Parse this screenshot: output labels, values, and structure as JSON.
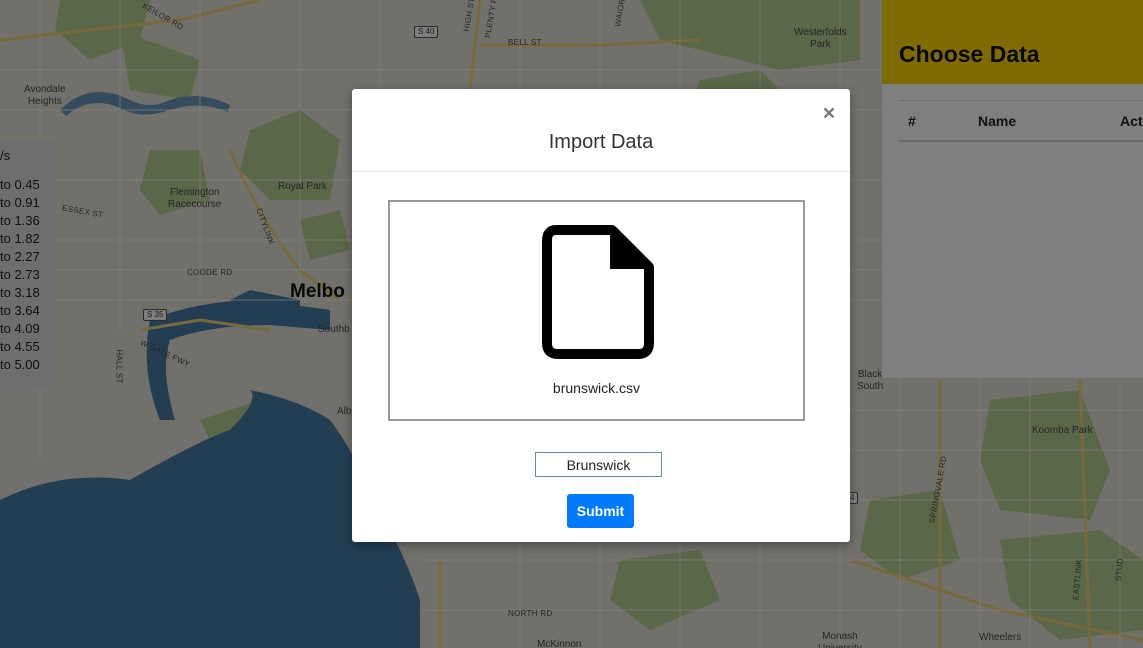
{
  "map": {
    "labels": {
      "avondale_heights": "Avondale\nHeights",
      "flemington_racecourse": "Flemington\nRacecourse",
      "royal_park": "Royal Park",
      "melbourne": "Melbo",
      "southbank": "Southb",
      "westerfolds_park": "Westerfolds\nPark",
      "koomba_park": "Koomba Park",
      "black_south": "Black\nSouth",
      "wheelers": "Wheelers",
      "monash_university": "Monash\nUniversity",
      "mckinnon": "McKinnon",
      "albert": "Alb"
    },
    "roads": {
      "keilor_rd": "KEILOR RD",
      "essex_st": "ESSEX ST",
      "coode_rd": "COODE RD",
      "hall_st": "HALL ST",
      "w_gate_fwy": "W GATE FWY",
      "bell_st": "BELL ST",
      "high_st": "HIGH ST",
      "plenty_rd": "PLENTY RD",
      "citylink": "CITYLINK",
      "north_rd": "NORTH RD",
      "springvale_rd": "SPRINGVALE RD",
      "eastlink": "EASTLINK",
      "std": "STUD",
      "waior": "WAIOR"
    },
    "shields": {
      "s40": "S 40",
      "s35": "S 35",
      "s4": "4"
    },
    "colors": {
      "land": "#e4e0d6",
      "park": "#b5cf90",
      "water": "#477ca6",
      "road": "#ffffff",
      "major_road": "#f3d98a"
    }
  },
  "legend": {
    "title": "/s",
    "items": [
      "to 0.45",
      "to 0.91",
      "to 1.36",
      "to 1.82",
      "to 2.27",
      "to 2.73",
      "to 3.18",
      "to 3.64",
      "to 4.09",
      "to 4.55",
      "to 5.00"
    ]
  },
  "panel": {
    "title": "Choose Data",
    "columns": [
      "#",
      "Name",
      "Act"
    ],
    "header_color": "#ffd700"
  },
  "modal": {
    "title": "Import Data",
    "close_label": "×",
    "file_icon": "file-icon",
    "file_name": "brunswick.csv",
    "name_input_value": "Brunswick",
    "submit_label": "Submit",
    "submit_color": "#007bff"
  }
}
